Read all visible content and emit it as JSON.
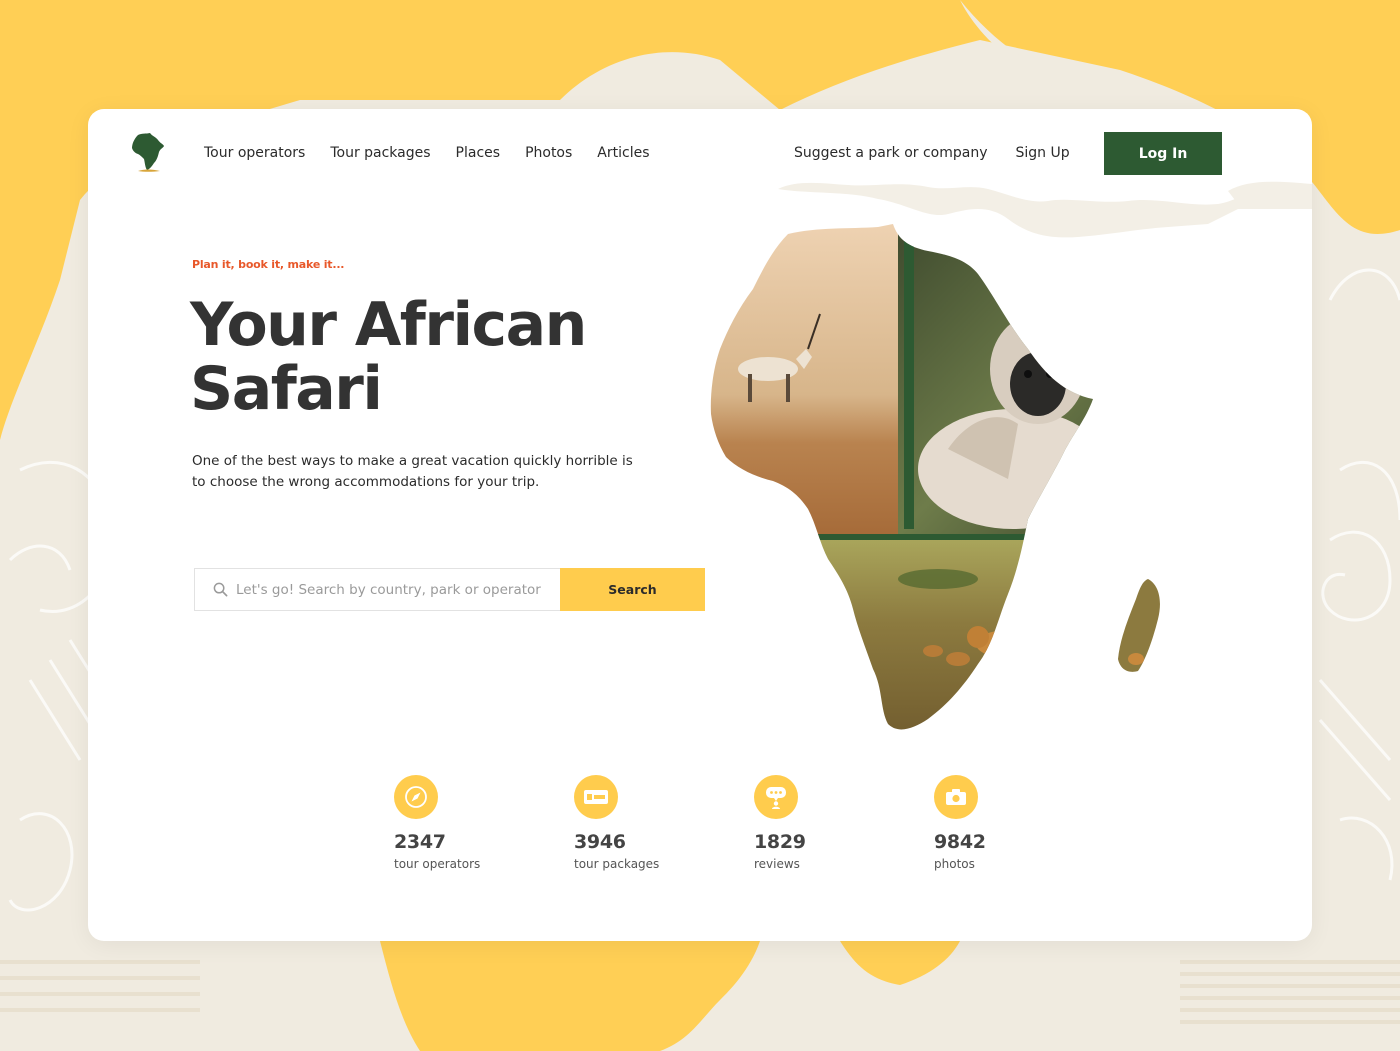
{
  "nav": {
    "items": [
      "Tour operators",
      "Tour packages",
      "Places",
      "Photos",
      "Articles"
    ],
    "suggest": "Suggest a park or company",
    "signup": "Sign Up",
    "login": "Log In"
  },
  "hero": {
    "tagline": "Plan it, book it, make it...",
    "title_line1": "Your African",
    "title_line2": "Safari",
    "description": "One of the best ways to make a great vacation quickly horrible is to choose the wrong accommodations for your trip."
  },
  "search": {
    "placeholder": "Let's go! Search by country, park or operator",
    "button": "Search"
  },
  "stats": [
    {
      "value": "2347",
      "label": "tour operators",
      "icon": "compass-icon"
    },
    {
      "value": "3946",
      "label": "tour packages",
      "icon": "ticket-icon"
    },
    {
      "value": "1829",
      "label": "reviews",
      "icon": "review-icon"
    },
    {
      "value": "9842",
      "label": "photos",
      "icon": "camera-icon"
    }
  ],
  "colors": {
    "brand_green": "#2d5a32",
    "accent_yellow": "#ffcc4d",
    "tagline_orange": "#e8582a",
    "background_beige": "#f0ebe0",
    "background_yellow": "#ffcf55"
  }
}
